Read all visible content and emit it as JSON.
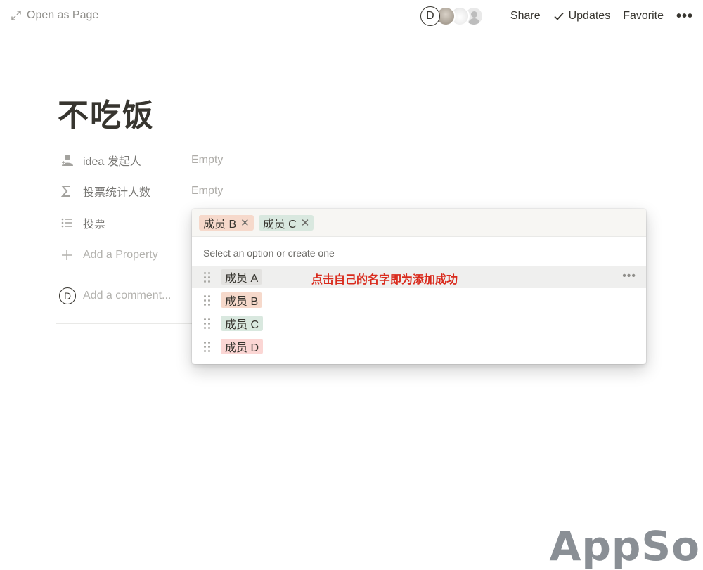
{
  "topbar": {
    "open_as_page": "Open as Page",
    "avatar_initial": "D",
    "share": "Share",
    "updates": "Updates",
    "favorite": "Favorite",
    "more": "•••"
  },
  "page": {
    "title": "不吃饭"
  },
  "properties": [
    {
      "icon": "person-icon",
      "name": "idea 发起人",
      "value": "Empty"
    },
    {
      "icon": "sigma-icon",
      "name": "投票统计人数",
      "value": "Empty"
    },
    {
      "icon": "list-icon",
      "name": "投票",
      "value": ""
    }
  ],
  "add_property": {
    "icon": "plus-icon",
    "label": "Add a Property"
  },
  "comment": {
    "avatar_initial": "D",
    "placeholder": "Add a comment..."
  },
  "dropdown": {
    "selected": [
      {
        "label": "成员 B",
        "color": "#f6d9cb"
      },
      {
        "label": "成员 C",
        "color": "#d9e8df"
      }
    ],
    "remove_glyph": "✕",
    "hint": "Select an option or create one",
    "options": [
      {
        "label": "成员 A",
        "color": "#e3e2e0",
        "hovered": true
      },
      {
        "label": "成员 B",
        "color": "#f6d9cb",
        "hovered": false
      },
      {
        "label": "成员 C",
        "color": "#d9e8df",
        "hovered": false
      },
      {
        "label": "成员 D",
        "color": "#fbd6d4",
        "hovered": false
      }
    ],
    "option_more": "•••",
    "annotation": "点击自己的名字即为添加成功"
  },
  "watermark": "AppSo"
}
